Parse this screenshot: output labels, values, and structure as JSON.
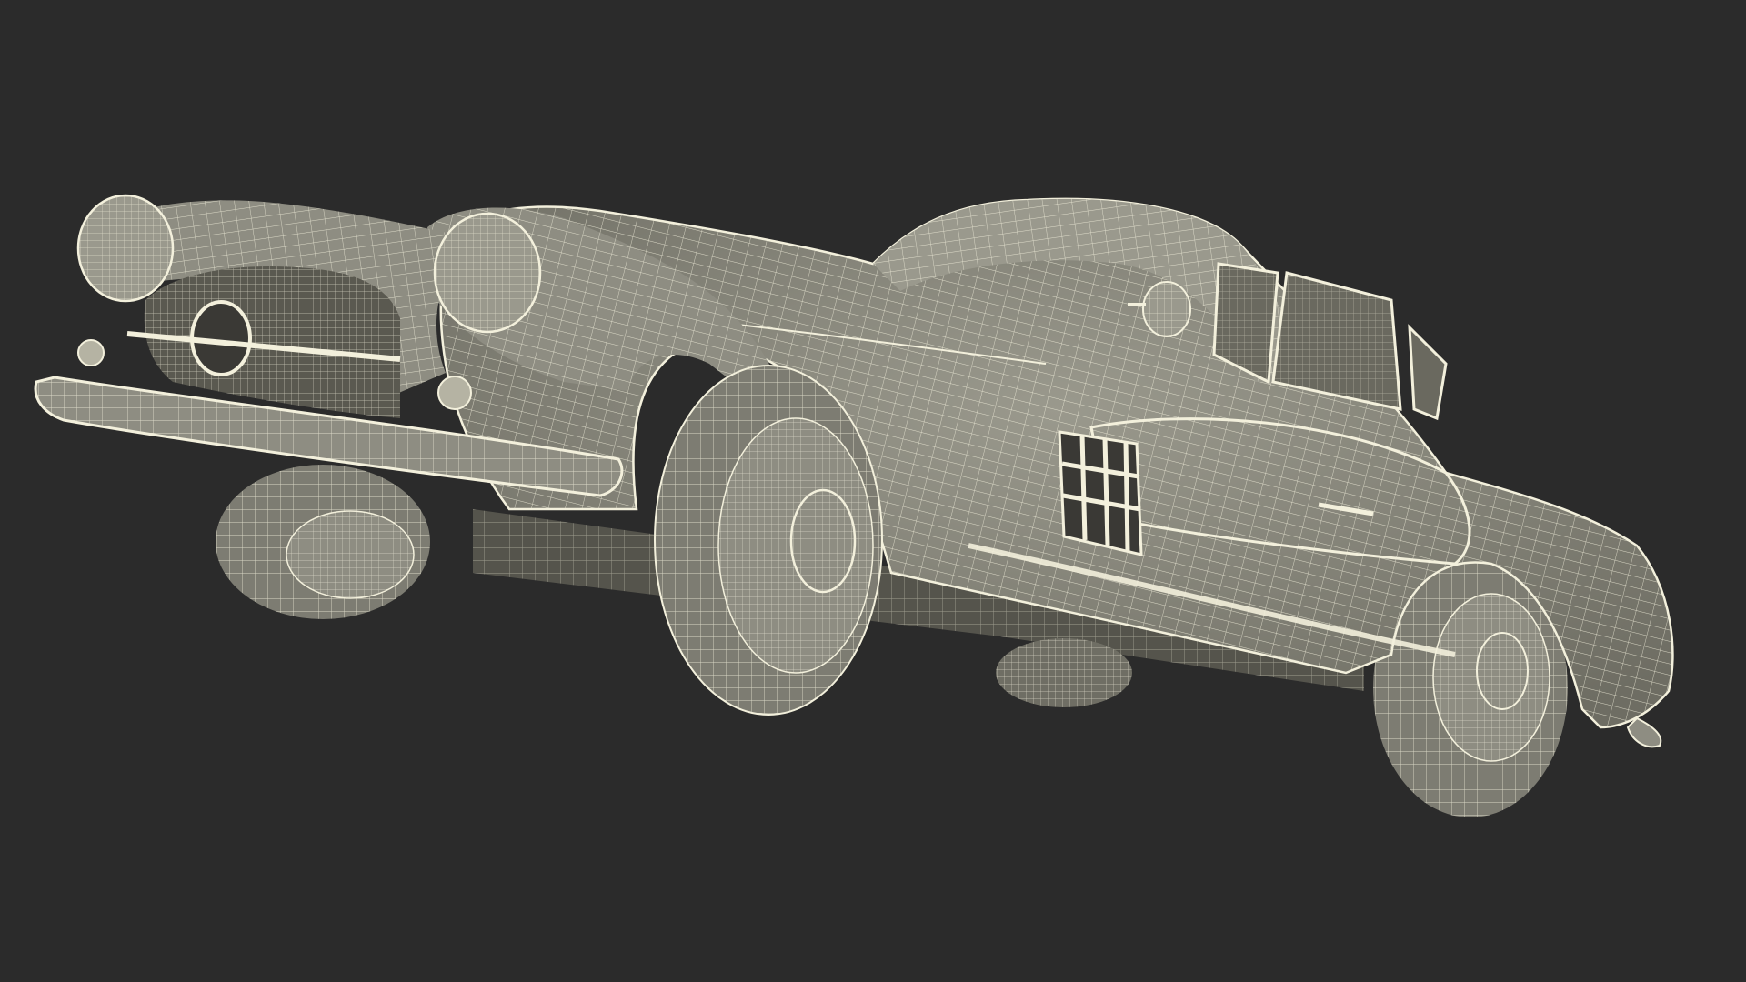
{
  "scene": {
    "subject": "car-wireframe",
    "colors": {
      "background": "#2b2b2b",
      "body_fill": "#8e8d82",
      "body_shadow": "#6f6e64",
      "body_dark": "#55544c",
      "wire": "#f3f0dc",
      "tire": "#7d7c72",
      "grille_dark": "#3a3935"
    }
  }
}
